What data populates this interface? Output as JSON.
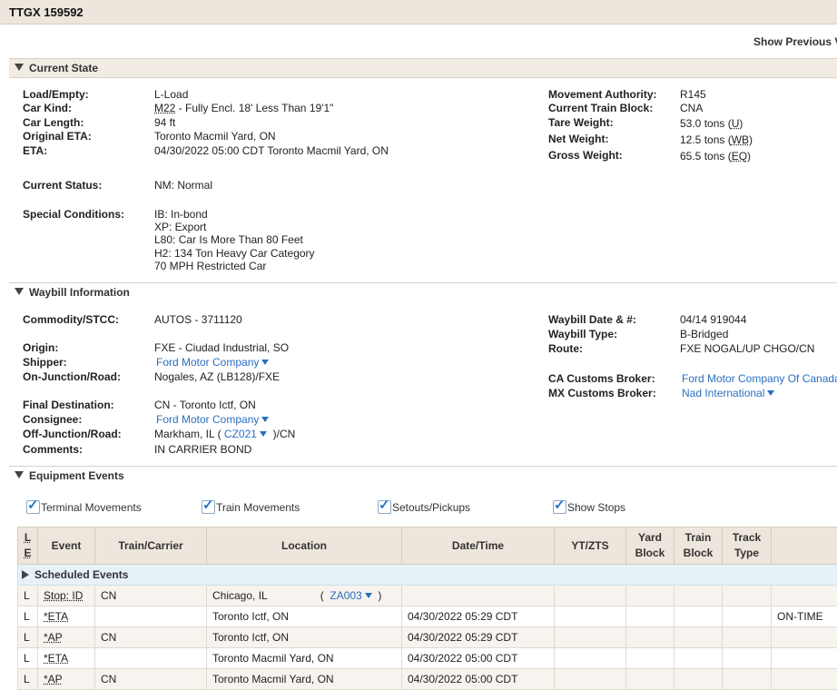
{
  "header": {
    "car_id": "TTGX 159592",
    "show_previous": "Show Previous V"
  },
  "current_state": {
    "title": "Current State",
    "left": [
      {
        "label": "Load/Empty:",
        "value": "L-Load"
      },
      {
        "label": "Car Kind:",
        "code": "M22",
        "value": " - Fully Encl. 18' Less Than 19'1\""
      },
      {
        "label": "Car Length:",
        "value": "94 ft"
      },
      {
        "label": "Original ETA:",
        "value": "Toronto Macmil Yard, ON"
      },
      {
        "label": "ETA:",
        "value": "04/30/2022 05:00 CDT Toronto Macmil Yard, ON"
      }
    ],
    "current_status_label": "Current Status:",
    "current_status": "NM: Normal",
    "special_conditions_label": "Special Conditions:",
    "special_conditions": [
      "IB: In-bond",
      "XP: Export",
      "L80: Car Is More Than 80 Feet",
      "H2: 134 Ton Heavy Car Category",
      "70 MPH Restricted Car"
    ],
    "right": [
      {
        "label": "Movement Authority:",
        "value": "R145"
      },
      {
        "label": "Current Train Block:",
        "value": "CNA"
      },
      {
        "label": "Tare Weight:",
        "value": "53.0 tons (",
        "code": "U",
        "suffix": ")"
      },
      {
        "label": "Net Weight:",
        "value": "12.5 tons (",
        "code": "WB",
        "suffix": ")"
      },
      {
        "label": "Gross Weight:",
        "value": "65.5 tons (",
        "code": "EQ",
        "suffix": ")"
      }
    ]
  },
  "waybill": {
    "title": "Waybill Information",
    "commodity_label": "Commodity/STCC:",
    "commodity": "AUTOS - 3711120",
    "origin_label": "Origin:",
    "origin": "FXE - Ciudad Industrial, SO",
    "shipper_label": "Shipper:",
    "shipper": "Ford Motor Company",
    "on_junction_label": "On-Junction/Road:",
    "on_junction": "Nogales, AZ (LB128)/FXE",
    "final_dest_label": "Final Destination:",
    "final_dest": "CN - Toronto Ictf, ON",
    "consignee_label": "Consignee:",
    "consignee": "Ford Motor Company",
    "off_junction_label": "Off-Junction/Road:",
    "off_junction_pre": "Markham, IL (",
    "off_junction_code": "CZ021",
    "off_junction_post": ")/CN",
    "comments_label": "Comments:",
    "comments": "IN CARRIER BOND",
    "waybill_date_label": "Waybill Date & #:",
    "waybill_date": "04/14 919044",
    "waybill_type_label": "Waybill Type:",
    "waybill_type": "B-Bridged",
    "route_label": "Route:",
    "route": "FXE NOGAL/UP CHGO/CN",
    "ca_broker_label": "CA Customs Broker:",
    "ca_broker": "Ford Motor Company Of Canada",
    "mx_broker_label": "MX Customs Broker:",
    "mx_broker": "Nad International"
  },
  "equipment_events": {
    "title": "Equipment Events",
    "filters": [
      "Terminal Movements",
      "Train Movements",
      "Setouts/Pickups",
      "Show Stops"
    ],
    "columns": {
      "le_l": "L",
      "le_e": "E",
      "event": "Event",
      "train": "Train/Carrier",
      "location": "Location",
      "datetime": "Date/Time",
      "ytzts": "YT/ZTS",
      "yard_block_1": "Yard",
      "yard_block_2": "Block",
      "train_block_1": "Train",
      "train_block_2": "Block",
      "track_type_1": "Track",
      "track_type_2": "Type"
    },
    "scheduled_label": "Scheduled Events",
    "rows": [
      {
        "le": "L",
        "event": "Stop: ID",
        "carrier": "CN",
        "location": "Chicago, IL",
        "loc_code": "ZA003",
        "datetime": "",
        "status": ""
      },
      {
        "le": "L",
        "event": "*ETA",
        "carrier": "",
        "location": "Toronto Ictf, ON",
        "loc_code": "",
        "datetime": "04/30/2022 05:29 CDT",
        "status": "ON-TIME"
      },
      {
        "le": "L",
        "event": "*AP",
        "carrier": "CN",
        "location": "Toronto Ictf, ON",
        "loc_code": "",
        "datetime": "04/30/2022 05:29 CDT",
        "status": ""
      },
      {
        "le": "L",
        "event": "*ETA",
        "carrier": "",
        "location": "Toronto Macmil Yard, ON",
        "loc_code": "",
        "datetime": "04/30/2022 05:00 CDT",
        "status": ""
      },
      {
        "le": "L",
        "event": "*AP",
        "carrier": "CN",
        "location": "Toronto Macmil Yard, ON",
        "loc_code": "",
        "datetime": "04/30/2022 05:00 CDT",
        "status": ""
      }
    ]
  }
}
